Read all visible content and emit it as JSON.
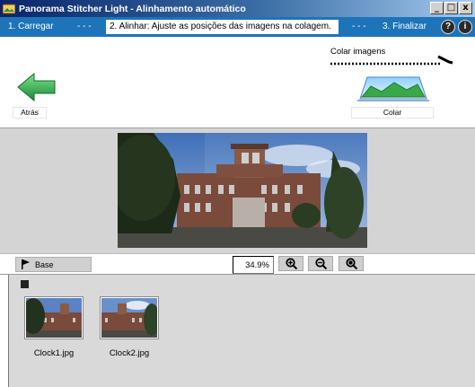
{
  "window": {
    "title": "Panorama Stitcher Light - Alinhamento automático",
    "buttons": {
      "minimize": "_",
      "maximize": "□",
      "close": "x"
    }
  },
  "steps": {
    "step1": "1. Carregar",
    "sep1": "- - -",
    "step2": "2. Alinhar: Ajuste as posições das imagens na colagem.",
    "sep2": "- - -",
    "step3": "3. Finalizar",
    "help": "?",
    "info": "i"
  },
  "nav": {
    "back_label": "Atrás",
    "colar_top_label": "Colar imagens",
    "colar_label": "Colar"
  },
  "toolbar": {
    "base_label": "Base",
    "zoom_value": "34.9%",
    "zoom_in_icon": "zoom-in-icon",
    "zoom_out_icon": "zoom-out-icon",
    "zoom_fit_icon": "zoom-fit-icon"
  },
  "thumbnails": [
    {
      "label": "Clock1.jpg"
    },
    {
      "label": "Clock2.jpg"
    }
  ],
  "colors": {
    "step_bar": "#1d74b8",
    "accent_green": "#2fa84f",
    "work_area": "#d4d4d4"
  }
}
